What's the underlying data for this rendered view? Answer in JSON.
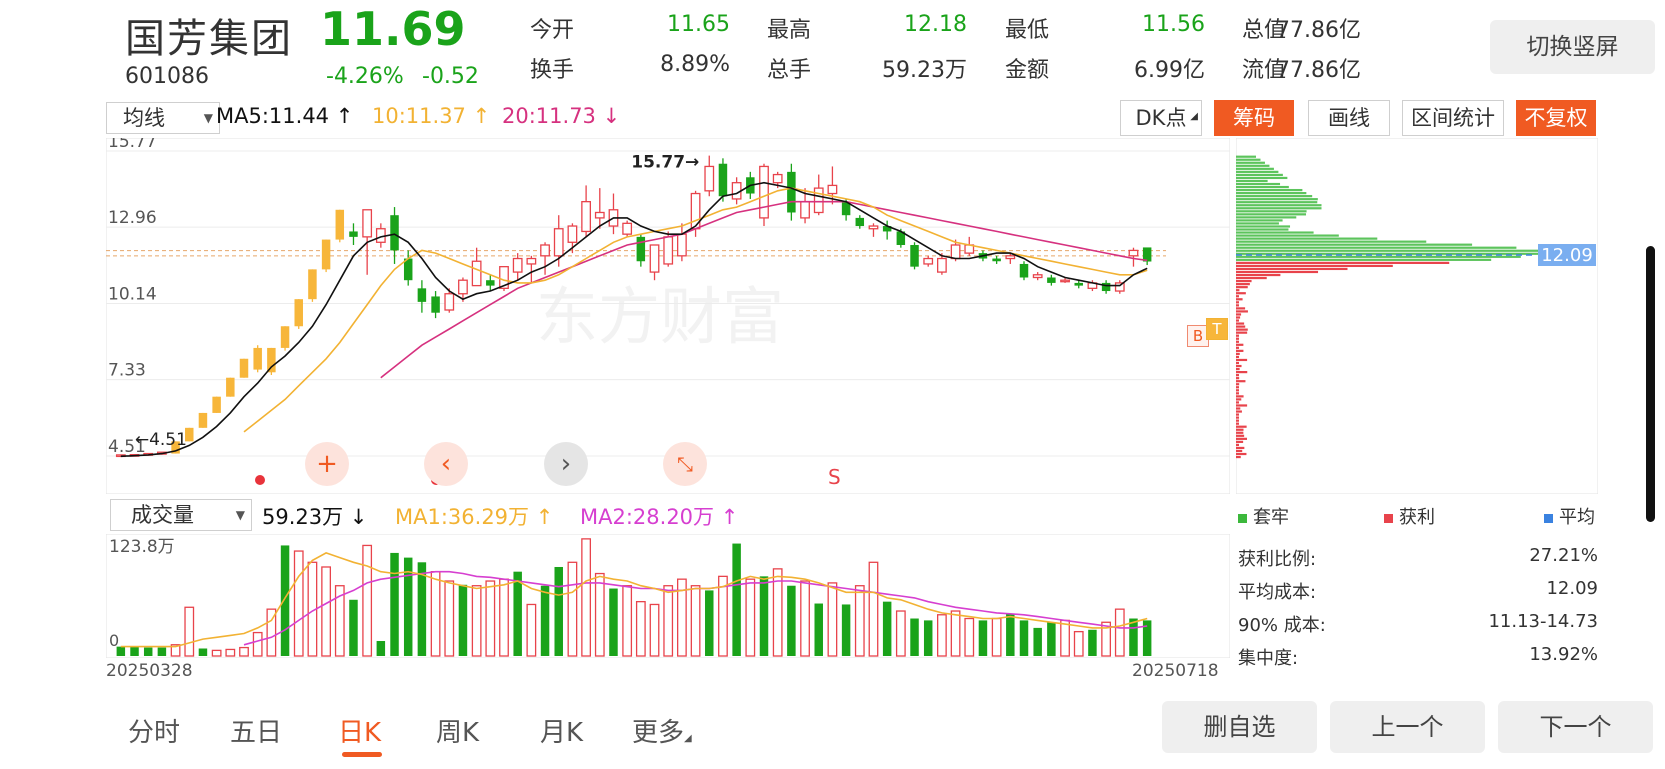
{
  "header": {
    "stock_name": "国芳集团",
    "price": "11.69",
    "code": "601086",
    "change_pct": "-4.26%",
    "change_amt": "-0.52",
    "switch_button": "切换竖屏",
    "quotes": [
      {
        "label": "今开",
        "value": "11.65",
        "color": "green"
      },
      {
        "label": "最高",
        "value": "12.18",
        "color": "green"
      },
      {
        "label": "最低",
        "value": "11.56",
        "color": "green"
      },
      {
        "label": "总值",
        "value": "77.86亿",
        "color": "dark"
      },
      {
        "label": "换手",
        "value": "8.89%",
        "color": "dark"
      },
      {
        "label": "总手",
        "value": "59.23万",
        "color": "dark"
      },
      {
        "label": "金额",
        "value": "6.99亿",
        "color": "dark"
      },
      {
        "label": "流值",
        "value": "77.86亿",
        "color": "dark"
      }
    ]
  },
  "toolbar": {
    "indicator_select": "均线",
    "ma5": "MA5:11.44",
    "ma10": "10:11.37",
    "ma20": "20:11.73",
    "dk_button": "DK点",
    "chip_button": "筹码",
    "draw_button": "画线",
    "range_button": "区间统计",
    "adjust_button": "不复权"
  },
  "price_axis": [
    "15.77",
    "12.96",
    "10.14",
    "7.33",
    "4.51"
  ],
  "annotations": {
    "high_marker": "15.77→",
    "low_marker": "←4.51",
    "sell_marker": "S",
    "buy_badge": "B",
    "t_badge": "T",
    "watermark": "东方财富",
    "avg_cost_tag": "12.09"
  },
  "volume": {
    "indicator_select": "成交量",
    "vol_value": "59.23万",
    "ma1": "MA1:36.29万",
    "ma2": "MA2:28.20万",
    "axis_top": "123.8万",
    "axis_zero": "0",
    "date_start": "20250328",
    "date_end": "20250718"
  },
  "chip_panel": {
    "legend": [
      {
        "label": "套牢",
        "color": "#3cb83c"
      },
      {
        "label": "获利",
        "color": "#e8434b"
      },
      {
        "label": "平均",
        "color": "#3a82e0"
      }
    ],
    "stats": [
      {
        "label": "获利比例:",
        "value": "27.21%"
      },
      {
        "label": "平均成本:",
        "value": "12.09"
      },
      {
        "label": "90% 成本:",
        "value": "11.13-14.73"
      },
      {
        "label": "集中度:",
        "value": "13.92%"
      }
    ]
  },
  "tabs": [
    "分时",
    "五日",
    "日K",
    "周K",
    "月K",
    "更多"
  ],
  "bottom_buttons": {
    "remove": "删自选",
    "prev": "上一个",
    "next": "下一个"
  },
  "colors": {
    "up": "#e8434b",
    "down": "#1aa31a",
    "ma5": "#111111",
    "ma10": "#f2b233",
    "ma20": "#d6317f",
    "accent": "#f05a22"
  },
  "chart_data": {
    "type": "candlestick",
    "ylim": [
      4.51,
      15.77
    ],
    "candles": [
      [
        4.5,
        4.55,
        4.48,
        4.52
      ],
      [
        4.52,
        4.56,
        4.5,
        4.54
      ],
      [
        4.54,
        4.6,
        4.52,
        4.58
      ],
      [
        4.58,
        4.65,
        4.56,
        4.62
      ],
      [
        4.6,
        5.05,
        4.6,
        5.05
      ],
      [
        5.05,
        5.55,
        5.05,
        5.55
      ],
      [
        5.55,
        6.1,
        5.55,
        6.1
      ],
      [
        6.1,
        6.7,
        6.1,
        6.7
      ],
      [
        6.7,
        7.4,
        6.7,
        7.4
      ],
      [
        7.4,
        8.1,
        7.4,
        8.1
      ],
      [
        8.5,
        7.7,
        7.6,
        8.6
      ],
      [
        7.6,
        8.5,
        7.5,
        8.5
      ],
      [
        8.5,
        9.3,
        8.4,
        9.3
      ],
      [
        9.3,
        10.3,
        9.2,
        10.3
      ],
      [
        10.3,
        11.4,
        10.2,
        11.4
      ],
      [
        11.4,
        12.5,
        11.3,
        12.5
      ],
      [
        12.5,
        13.6,
        12.4,
        13.6
      ],
      [
        12.8,
        12.6,
        12.3,
        13.1
      ],
      [
        12.6,
        13.6,
        11.2,
        13.6
      ],
      [
        12.4,
        12.9,
        12.2,
        13.1
      ],
      [
        13.4,
        12.1,
        11.6,
        13.7
      ],
      [
        11.8,
        11.0,
        10.8,
        12.1
      ],
      [
        10.7,
        10.2,
        9.8,
        11.0
      ],
      [
        10.4,
        9.8,
        9.6,
        10.6
      ],
      [
        9.9,
        10.5,
        9.8,
        10.7
      ],
      [
        10.5,
        11.0,
        10.2,
        11.1
      ],
      [
        10.8,
        11.7,
        10.8,
        12.2
      ],
      [
        11.0,
        10.8,
        10.6,
        11.2
      ],
      [
        10.7,
        11.5,
        10.6,
        11.5
      ],
      [
        11.3,
        11.8,
        11.0,
        12.0
      ],
      [
        11.6,
        11.8,
        10.9,
        11.9
      ],
      [
        11.9,
        12.3,
        11.2,
        12.4
      ],
      [
        11.9,
        12.9,
        11.5,
        13.4
      ],
      [
        12.4,
        13.0,
        12.0,
        13.1
      ],
      [
        12.8,
        13.9,
        12.6,
        14.5
      ],
      [
        13.3,
        13.5,
        12.9,
        14.4
      ],
      [
        13.0,
        13.6,
        12.7,
        14.2
      ],
      [
        12.7,
        13.1,
        12.6,
        13.2
      ],
      [
        12.6,
        11.7,
        11.5,
        12.7
      ],
      [
        11.3,
        12.3,
        11.0,
        12.3
      ],
      [
        11.6,
        12.6,
        11.5,
        12.8
      ],
      [
        11.9,
        12.7,
        11.7,
        13.1
      ],
      [
        12.9,
        14.2,
        12.6,
        14.3
      ],
      [
        14.3,
        15.2,
        14.1,
        15.6
      ],
      [
        15.3,
        14.1,
        13.9,
        15.5
      ],
      [
        14.0,
        14.6,
        13.8,
        14.8
      ],
      [
        14.8,
        14.2,
        14.0,
        15.0
      ],
      [
        13.3,
        15.2,
        13.0,
        15.3
      ],
      [
        14.6,
        14.9,
        14.4,
        15.0
      ],
      [
        15.0,
        13.5,
        13.2,
        15.3
      ],
      [
        13.3,
        13.9,
        13.1,
        14.4
      ],
      [
        13.5,
        14.4,
        13.4,
        14.9
      ],
      [
        14.2,
        14.5,
        13.8,
        15.2
      ],
      [
        13.9,
        13.4,
        13.2,
        14.0
      ],
      [
        13.3,
        13.0,
        12.9,
        13.4
      ],
      [
        12.9,
        13.0,
        12.6,
        13.1
      ],
      [
        13.0,
        12.8,
        12.5,
        13.2
      ],
      [
        12.8,
        12.3,
        12.2,
        12.9
      ],
      [
        12.3,
        11.5,
        11.4,
        12.4
      ],
      [
        11.6,
        11.8,
        11.5,
        11.9
      ],
      [
        11.3,
        11.8,
        11.2,
        12.0
      ],
      [
        11.8,
        12.3,
        11.7,
        12.5
      ],
      [
        12.0,
        12.3,
        11.9,
        12.6
      ],
      [
        12.0,
        11.8,
        11.7,
        12.1
      ],
      [
        11.8,
        11.7,
        11.6,
        11.9
      ],
      [
        11.8,
        11.9,
        11.6,
        12.0
      ],
      [
        11.6,
        11.1,
        11.0,
        11.7
      ],
      [
        11.1,
        11.2,
        11.0,
        11.3
      ],
      [
        11.1,
        10.9,
        10.8,
        11.2
      ],
      [
        11.0,
        11.0,
        10.9,
        11.1
      ],
      [
        10.9,
        10.8,
        10.7,
        11.0
      ],
      [
        10.7,
        10.9,
        10.6,
        11.0
      ],
      [
        10.9,
        10.6,
        10.5,
        11.0
      ],
      [
        10.6,
        10.9,
        10.5,
        11.0
      ],
      [
        11.9,
        12.1,
        11.5,
        12.2
      ],
      [
        12.21,
        11.69,
        11.56,
        12.18
      ]
    ],
    "ma5": [
      4.5,
      4.52,
      4.55,
      4.6,
      4.7,
      4.9,
      5.2,
      5.6,
      6.1,
      6.7,
      7.2,
      7.8,
      8.2,
      8.7,
      9.3,
      10.1,
      11.0,
      11.9,
      12.4,
      12.6,
      12.7,
      12.4,
      11.8,
      11.1,
      10.6,
      10.3,
      10.5,
      10.6,
      10.8,
      11.0,
      11.3,
      11.5,
      11.8,
      12.2,
      12.6,
      13.0,
      13.3,
      13.3,
      13.0,
      12.8,
      12.7,
      12.7,
      13.0,
      13.6,
      14.1,
      14.2,
      14.5,
      14.6,
      14.5,
      14.4,
      14.2,
      14.1,
      14.0,
      13.9,
      13.6,
      13.3,
      13.0,
      12.8,
      12.5,
      12.2,
      11.9,
      11.8,
      11.8,
      11.9,
      12.0,
      12.0,
      11.8,
      11.5,
      11.3,
      11.1,
      11.0,
      10.9,
      10.8,
      10.8,
      11.2,
      11.44
    ],
    "ma10": [
      null,
      null,
      null,
      null,
      null,
      null,
      null,
      null,
      null,
      5.4,
      5.8,
      6.2,
      6.6,
      7.1,
      7.6,
      8.1,
      8.7,
      9.4,
      10.1,
      10.8,
      11.4,
      11.8,
      12.1,
      12.0,
      11.8,
      11.6,
      11.4,
      11.2,
      11.0,
      10.9,
      10.9,
      11.0,
      11.2,
      11.5,
      11.8,
      12.1,
      12.4,
      12.6,
      12.7,
      12.8,
      12.9,
      13.0,
      13.2,
      13.4,
      13.6,
      13.7,
      13.9,
      14.1,
      14.3,
      14.4,
      14.3,
      14.2,
      14.1,
      14.0,
      13.9,
      13.7,
      13.4,
      13.2,
      13.0,
      12.8,
      12.6,
      12.4,
      12.3,
      12.2,
      12.1,
      12.0,
      11.9,
      11.8,
      11.7,
      11.6,
      11.5,
      11.4,
      11.3,
      11.2,
      11.2,
      11.37
    ],
    "ma20": [
      null,
      null,
      null,
      null,
      null,
      null,
      null,
      null,
      null,
      null,
      null,
      null,
      null,
      null,
      null,
      null,
      null,
      null,
      null,
      7.4,
      7.8,
      8.2,
      8.6,
      8.9,
      9.2,
      9.5,
      9.8,
      10.1,
      10.4,
      10.7,
      10.9,
      11.1,
      11.3,
      11.5,
      11.7,
      11.9,
      12.1,
      12.3,
      12.4,
      12.5,
      12.6,
      12.7,
      12.9,
      13.1,
      13.3,
      13.5,
      13.6,
      13.7,
      13.8,
      13.9,
      13.9,
      13.9,
      13.9,
      13.9,
      13.8,
      13.7,
      13.6,
      13.5,
      13.4,
      13.3,
      13.2,
      13.1,
      13.0,
      12.9,
      12.8,
      12.7,
      12.6,
      12.5,
      12.4,
      12.3,
      12.2,
      12.1,
      12.0,
      11.9,
      11.8,
      11.73
    ],
    "volume": {
      "ylim": [
        0,
        123.8
      ],
      "values": [
        10,
        10,
        9,
        9,
        12,
        52,
        8,
        6,
        7,
        9,
        25,
        50,
        118,
        112,
        100,
        95,
        75,
        60,
        118,
        16,
        110,
        105,
        100,
        90,
        80,
        76,
        75,
        80,
        82,
        90,
        55,
        75,
        95,
        100,
        125,
        88,
        72,
        75,
        58,
        55,
        75,
        82,
        75,
        70,
        85,
        120,
        82,
        85,
        93,
        75,
        80,
        56,
        78,
        55,
        75,
        100,
        58,
        48,
        40,
        38,
        44,
        48,
        40,
        38,
        40,
        45,
        38,
        30,
        36,
        38,
        26,
        28,
        36,
        50,
        40,
        38
      ],
      "up": [
        0,
        0,
        0,
        0,
        1,
        1,
        0,
        1,
        1,
        1,
        1,
        1,
        0,
        1,
        1,
        1,
        1,
        0,
        1,
        0,
        0,
        0,
        0,
        1,
        1,
        0,
        1,
        1,
        1,
        0,
        1,
        0,
        0,
        1,
        1,
        1,
        0,
        1,
        1,
        1,
        1,
        1,
        1,
        0,
        1,
        0,
        1,
        0,
        1,
        0,
        1,
        0,
        1,
        0,
        1,
        1,
        0,
        1,
        0,
        0,
        1,
        1,
        1,
        0,
        1,
        0,
        0,
        0,
        0,
        1,
        1,
        0,
        1,
        1,
        0,
        0
      ],
      "ma1": [
        10,
        10,
        10,
        10,
        10,
        14,
        18,
        20,
        22,
        24,
        30,
        38,
        62,
        85,
        102,
        110,
        105,
        100,
        96,
        90,
        88,
        90,
        87,
        82,
        78,
        75,
        72,
        74,
        76,
        80,
        72,
        68,
        65,
        68,
        80,
        85,
        82,
        80,
        75,
        72,
        68,
        70,
        72,
        72,
        74,
        80,
        85,
        82,
        85,
        84,
        82,
        78,
        73,
        68,
        68,
        68,
        62,
        60,
        55,
        50,
        46,
        44,
        42,
        40,
        40,
        42,
        40,
        38,
        36,
        34,
        32,
        30,
        30,
        32,
        36,
        40
      ],
      "ma2": [
        null,
        null,
        null,
        null,
        null,
        null,
        null,
        null,
        null,
        12,
        16,
        20,
        28,
        38,
        48,
        56,
        64,
        70,
        78,
        82,
        84,
        86,
        88,
        90,
        90,
        88,
        85,
        84,
        82,
        80,
        78,
        76,
        74,
        76,
        78,
        78,
        76,
        74,
        72,
        72,
        70,
        70,
        72,
        72,
        74,
        76,
        78,
        78,
        80,
        80,
        78,
        76,
        74,
        72,
        70,
        68,
        66,
        64,
        62,
        58,
        55,
        52,
        50,
        48,
        46,
        45,
        44,
        42,
        40,
        38,
        36,
        34,
        32,
        30,
        30,
        32
      ]
    }
  }
}
